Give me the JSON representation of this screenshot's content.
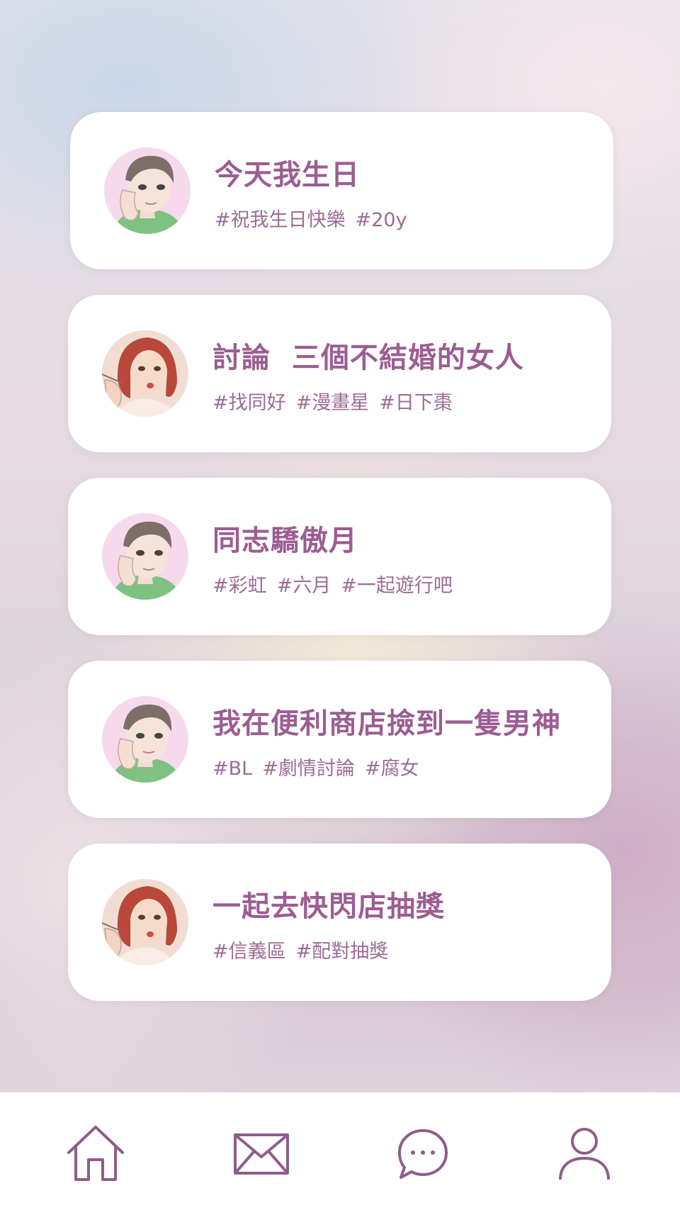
{
  "posts": [
    {
      "title": "今天我生日",
      "tags": [
        "#祝我生日快樂",
        "#20y"
      ],
      "avatar": "male-avatar-icon"
    },
    {
      "title": "討論  三個不結婚的女人",
      "tags": [
        "#找同好",
        "#漫畫星",
        "#日下棗"
      ],
      "avatar": "female-avatar-icon"
    },
    {
      "title": "同志驕傲月",
      "tags": [
        "#彩虹",
        "#六月",
        "#一起遊行吧"
      ],
      "avatar": "male-avatar-icon"
    },
    {
      "title": "我在便利商店撿到一隻男神",
      "tags": [
        "#BL",
        "#劇情討論",
        "#腐女"
      ],
      "avatar": "male-avatar-icon"
    },
    {
      "title": "一起去快閃店抽獎",
      "tags": [
        "#信義區",
        "#配對抽獎"
      ],
      "avatar": "female-avatar-icon"
    }
  ],
  "tabbar": {
    "items": [
      {
        "name": "home-icon"
      },
      {
        "name": "mail-icon"
      },
      {
        "name": "chat-icon"
      },
      {
        "name": "profile-icon"
      }
    ]
  },
  "colors": {
    "accent": "#9c5d92",
    "tag": "#9c6c96",
    "icon": "#8e5d8a"
  }
}
